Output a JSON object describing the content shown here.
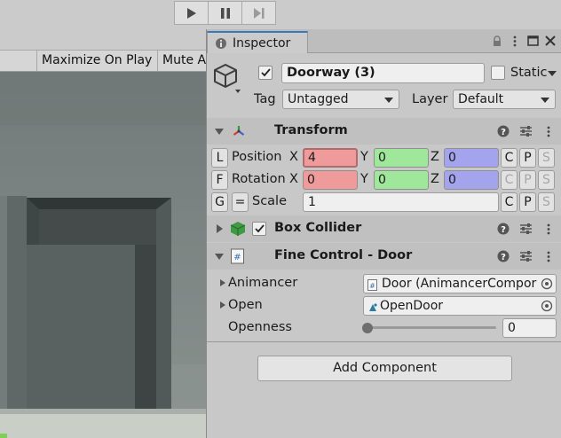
{
  "toolbar": {
    "play_icon": "play-icon",
    "pause_icon": "pause-icon",
    "step_icon": "step-icon"
  },
  "game_view": {
    "maximize_on_play": "Maximize On Play",
    "mute_audio": "Mute A"
  },
  "inspector": {
    "tab_label": "Inspector",
    "object_name": "Doorway (3)",
    "active_checked": true,
    "static_label": "Static",
    "static_checked": false,
    "tag_label": "Tag",
    "tag_value": "Untagged",
    "layer_label": "Layer",
    "layer_value": "Default",
    "transform": {
      "title": "Transform",
      "position_btn": "L",
      "position_label": "Position",
      "position": {
        "x": "4",
        "y": "0",
        "z": "0"
      },
      "rotation_btn": "F",
      "rotation_label": "Rotation",
      "rotation": {
        "x": "0",
        "y": "0",
        "z": "0"
      },
      "scale_btn": "G",
      "scale_link": "=",
      "scale_label": "Scale",
      "scale_value": "1",
      "axis_x": "X",
      "axis_y": "Y",
      "axis_z": "Z",
      "btn_c": "C",
      "btn_p": "P",
      "btn_s": "S"
    },
    "box_collider": {
      "title": "Box Collider",
      "enabled": true
    },
    "fine_control": {
      "title": "Fine Control - Door",
      "animancer_label": "Animancer",
      "animancer_value": "Door (AnimancerCompor",
      "open_label": "Open",
      "open_value": "OpenDoor",
      "openness_label": "Openness",
      "openness_value": "0",
      "openness_fraction": 0
    },
    "add_component": "Add Component"
  }
}
